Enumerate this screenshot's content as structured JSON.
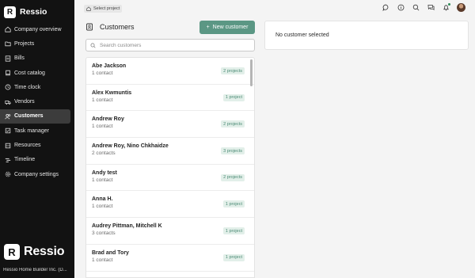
{
  "brand": {
    "name": "Ressio",
    "logo_letter": "R"
  },
  "sidebar": {
    "items": [
      {
        "label": "Company overview",
        "icon": "home-icon",
        "active": false
      },
      {
        "label": "Projects",
        "icon": "folder-icon",
        "active": false
      },
      {
        "label": "Bills",
        "icon": "bill-icon",
        "active": false
      },
      {
        "label": "Cost catalog",
        "icon": "book-icon",
        "active": false
      },
      {
        "label": "Time clock",
        "icon": "clock-icon",
        "active": false
      },
      {
        "label": "Vendors",
        "icon": "truck-icon",
        "active": false
      },
      {
        "label": "Customers",
        "icon": "customers-icon",
        "active": true
      },
      {
        "label": "Task manager",
        "icon": "task-icon",
        "active": false
      },
      {
        "label": "Resources",
        "icon": "resources-icon",
        "active": false
      },
      {
        "label": "Timeline",
        "icon": "timeline-icon",
        "active": false
      },
      {
        "label": "Company settings",
        "icon": "gear-icon",
        "active": false
      }
    ],
    "footer_brand": "Ressio",
    "company": "Ressio Home Builder Inc. (D..."
  },
  "topbar": {
    "select_project": "Select project",
    "icons": [
      "chat-icon",
      "help-icon",
      "search-icon",
      "messages-icon",
      "bell-icon",
      "user-avatar"
    ]
  },
  "customers": {
    "title": "Customers",
    "new_button": "New customer",
    "search_placeholder": "Search customers",
    "rows": [
      {
        "name": "Abe Jackson",
        "contacts": "1 contact",
        "projects": "2 projects"
      },
      {
        "name": "Alex Kwmuntis",
        "contacts": "1 contact",
        "projects": "1 project"
      },
      {
        "name": "Andrew Roy",
        "contacts": "1 contact",
        "projects": "2 projects"
      },
      {
        "name": "Andrew Roy, Nino Chkhaidze",
        "contacts": "2 contacts",
        "projects": "3 projects"
      },
      {
        "name": "Andy test",
        "contacts": "1 contact",
        "projects": "2 projects"
      },
      {
        "name": "Anna H.",
        "contacts": "1 contact",
        "projects": "1 project"
      },
      {
        "name": "Audrey Pittman, Mitchell K",
        "contacts": "3 contacts",
        "projects": "1 project"
      },
      {
        "name": "Brad and Tory",
        "contacts": "1 contact",
        "projects": "1 project"
      }
    ]
  },
  "detail": {
    "empty_text": "No customer selected"
  },
  "colors": {
    "sidebar_bg": "#121212",
    "accent": "#5b9784",
    "badge_bg": "#e2efe9",
    "badge_text": "#4a8a74"
  }
}
